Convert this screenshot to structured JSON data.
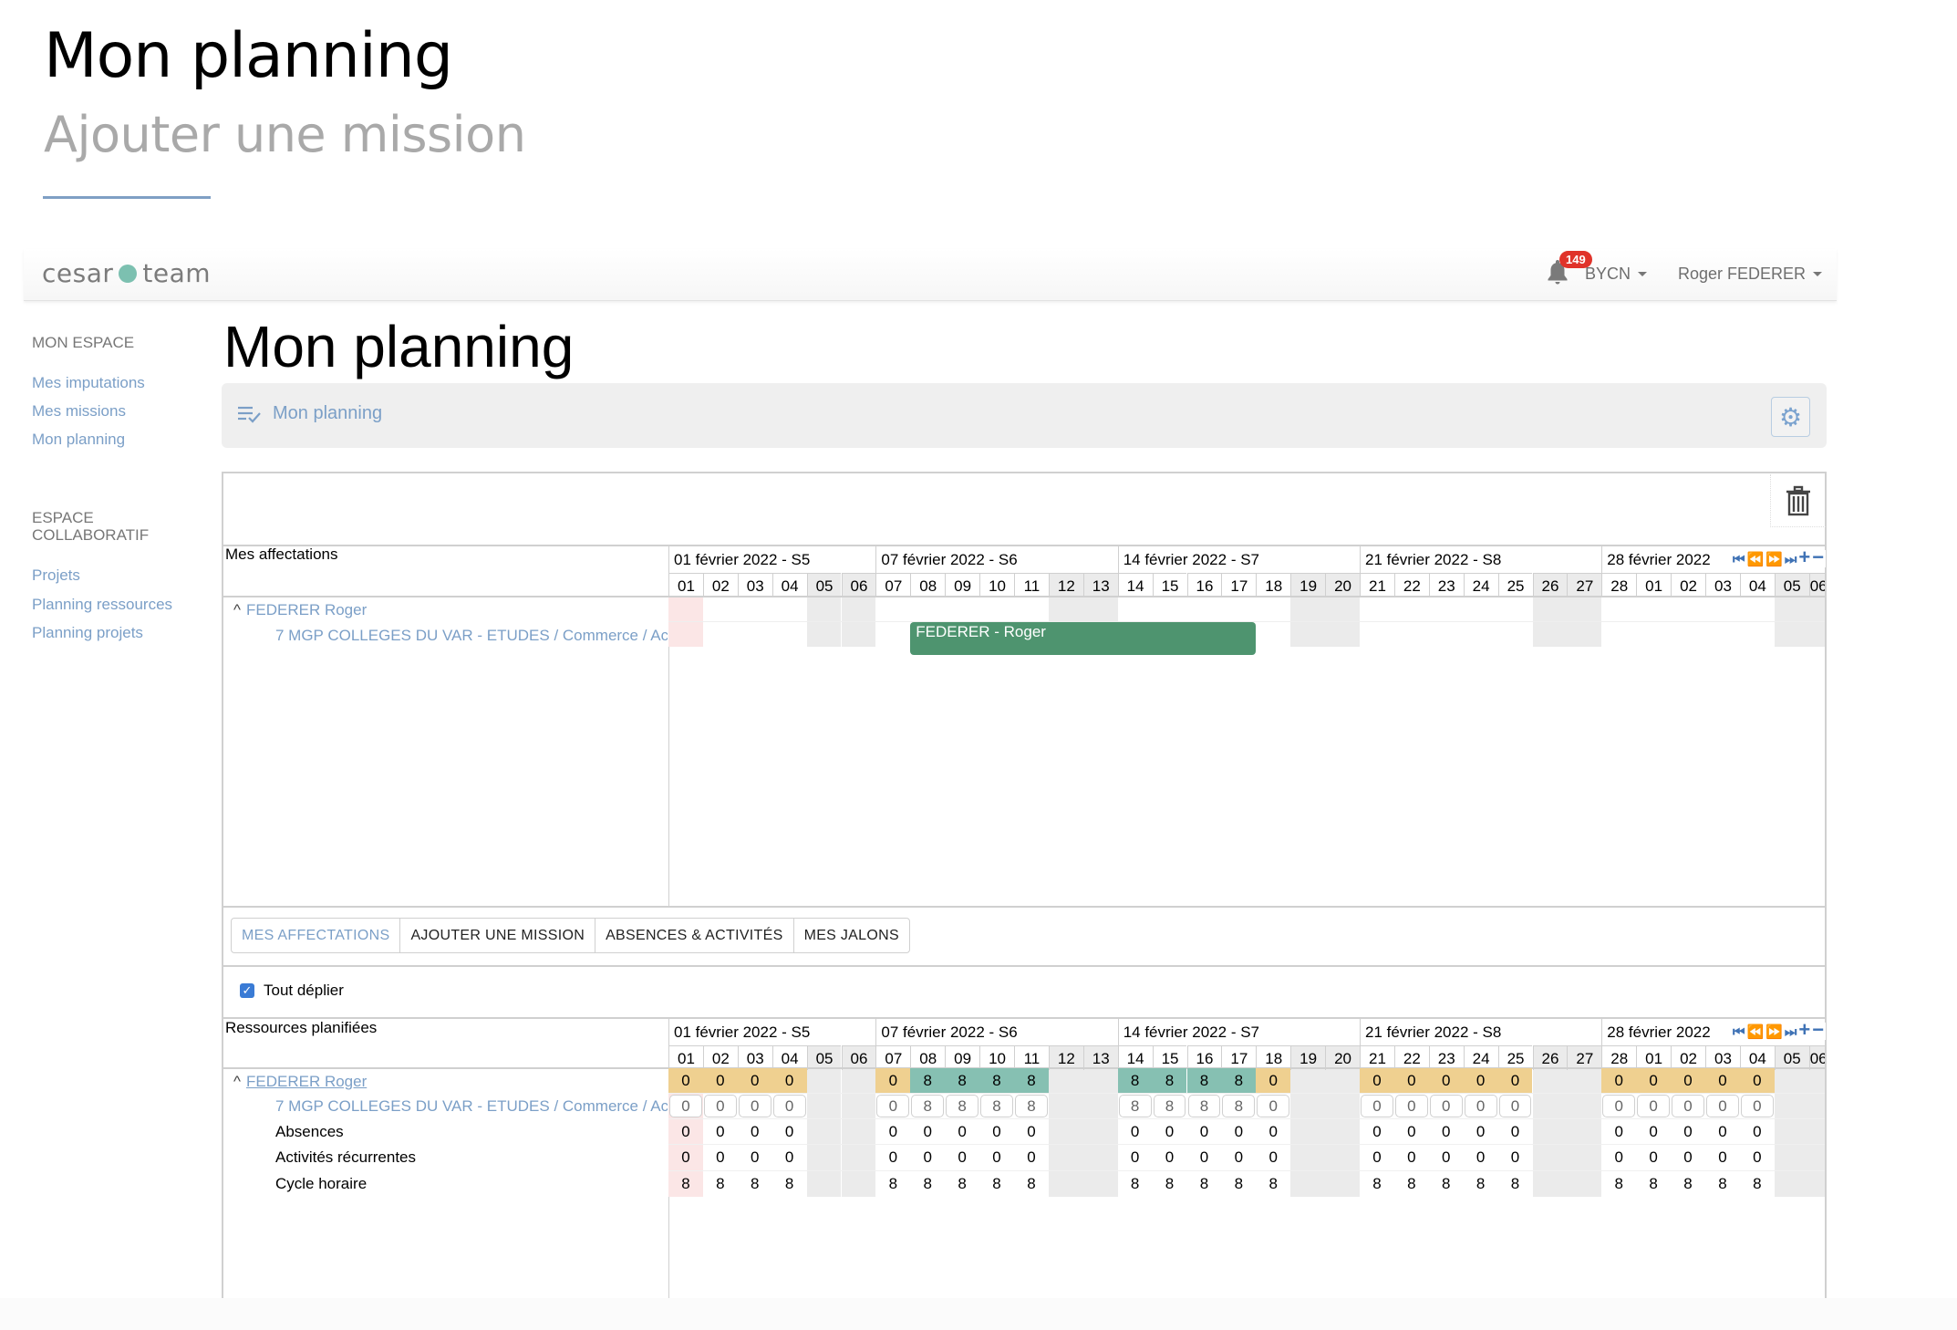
{
  "doc": {
    "title": "Mon planning",
    "subtitle": "Ajouter une mission"
  },
  "header": {
    "logo_left": "cesar",
    "logo_right": "team",
    "notifications_count": "149",
    "company_menu": "BYCN",
    "user_menu": "Roger FEDERER"
  },
  "sidebar": {
    "section1": "MON ESPACE",
    "section1_items": [
      "Mes imputations",
      "Mes missions",
      "Mon planning"
    ],
    "section2_line1": "ESPACE",
    "section2_line2": "COLLABORATIF",
    "section2_items": [
      "Projets",
      "Planning ressources",
      "Planning projets"
    ]
  },
  "page": {
    "title": "Mon planning",
    "panel_title": "Mon planning"
  },
  "colors": {
    "accent": "#7b9fc7",
    "bar": "#4e946f",
    "teal": "#86c0b2",
    "orange": "#efd090",
    "weekend": "#ebebeb",
    "today": "#fbe6e6",
    "nav": "#3f72b5"
  },
  "weeks": [
    {
      "label": "01 février 2022 - S5",
      "start": 0,
      "days": 6
    },
    {
      "label": "07 février 2022 - S6",
      "start": 6,
      "days": 7
    },
    {
      "label": "14 février 2022 - S7",
      "start": 13,
      "days": 7
    },
    {
      "label": "21 février 2022 - S8",
      "start": 20,
      "days": 7
    },
    {
      "label": "28 février 2022",
      "start": 27,
      "days": 7
    }
  ],
  "days": [
    "01",
    "02",
    "03",
    "04",
    "05",
    "06",
    "07",
    "08",
    "09",
    "10",
    "11",
    "12",
    "13",
    "14",
    "15",
    "16",
    "17",
    "18",
    "19",
    "20",
    "21",
    "22",
    "23",
    "24",
    "25",
    "26",
    "27",
    "28",
    "01",
    "02",
    "03",
    "04",
    "05",
    "06"
  ],
  "weekend_indexes": [
    4,
    5,
    11,
    12,
    18,
    19,
    25,
    26,
    32,
    33
  ],
  "today_index": 0,
  "nav_icons": [
    "first-icon",
    "prev-icon",
    "next-icon",
    "last-icon",
    "zoom-in-icon",
    "zoom-out-icon"
  ],
  "upper": {
    "header_label": "Mes affectations",
    "resource": "FEDERER Roger",
    "mission": "7 MGP COLLEGES DU VAR - ETUDES / Commerce / Ac",
    "bar": {
      "label": "FEDERER - Roger",
      "start_day": "08",
      "end_day": "17",
      "start_index": 7,
      "end_index": 16
    }
  },
  "tabs": [
    {
      "label": "MES AFFECTATIONS",
      "active": true
    },
    {
      "label": "AJOUTER UNE MISSION",
      "active": false
    },
    {
      "label": "ABSENCES & ACTIVITÉS",
      "active": false
    },
    {
      "label": "MES JALONS",
      "active": false
    }
  ],
  "expand_all": {
    "label": "Tout déplier",
    "checked": true
  },
  "lower": {
    "header_label": "Ressources planifiées",
    "resource": "FEDERER Roger",
    "rows": [
      {
        "label": "7 MGP COLLEGES DU VAR - ETUDES / Commerce / Ac",
        "kind": "input"
      },
      {
        "label": "Absences",
        "kind": "plain"
      },
      {
        "label": "Activités récurrentes",
        "kind": "plain"
      },
      {
        "label": "Cycle horaire",
        "kind": "plain"
      }
    ],
    "workdays": [
      0,
      1,
      2,
      3,
      6,
      7,
      8,
      9,
      10,
      13,
      14,
      15,
      16,
      17,
      20,
      21,
      22,
      23,
      24,
      27,
      28,
      29,
      30,
      31
    ],
    "total": [
      "0",
      "0",
      "0",
      "0",
      "0",
      "8",
      "8",
      "8",
      "8",
      "8",
      "8",
      "8",
      "8",
      "0",
      "0",
      "0",
      "0",
      "0",
      "0",
      "0",
      "0",
      "0",
      "0",
      "0"
    ],
    "mission": [
      "0",
      "0",
      "0",
      "0",
      "0",
      "8",
      "8",
      "8",
      "8",
      "8",
      "8",
      "8",
      "8",
      "0",
      "0",
      "0",
      "0",
      "0",
      "0",
      "0",
      "0",
      "0",
      "0",
      "0"
    ],
    "absences": [
      "0",
      "0",
      "0",
      "0",
      "0",
      "0",
      "0",
      "0",
      "0",
      "0",
      "0",
      "0",
      "0",
      "0",
      "0",
      "0",
      "0",
      "0",
      "0",
      "0",
      "0",
      "0",
      "0",
      "0"
    ],
    "recurrent": [
      "0",
      "0",
      "0",
      "0",
      "0",
      "0",
      "0",
      "0",
      "0",
      "0",
      "0",
      "0",
      "0",
      "0",
      "0",
      "0",
      "0",
      "0",
      "0",
      "0",
      "0",
      "0",
      "0",
      "0"
    ],
    "cycle": [
      "8",
      "8",
      "8",
      "8",
      "8",
      "8",
      "8",
      "8",
      "8",
      "8",
      "8",
      "8",
      "8",
      "8",
      "8",
      "8",
      "8",
      "8",
      "8",
      "8",
      "8",
      "8",
      "8",
      "8"
    ]
  }
}
